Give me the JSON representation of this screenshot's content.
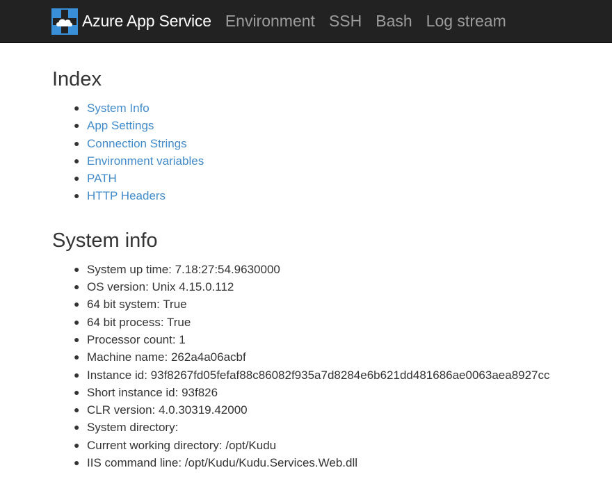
{
  "navbar": {
    "brand": "Azure App Service",
    "brand_icon": "azure-app-service-icon",
    "links": [
      "Environment",
      "SSH",
      "Bash",
      "Log stream"
    ]
  },
  "index": {
    "heading": "Index",
    "items": [
      "System Info",
      "App Settings",
      "Connection Strings",
      "Environment variables",
      "PATH",
      "HTTP Headers"
    ]
  },
  "system_info": {
    "heading": "System info",
    "items": [
      "System up time: 7.18:27:54.9630000",
      "OS version: Unix 4.15.0.112",
      "64 bit system: True",
      "64 bit process: True",
      "Processor count: 1",
      "Machine name: 262a4a06acbf",
      "Instance id: 93f8267fd05fefaf88c86082f935a7d8284e6b621dd481686ae0063aea8927cc",
      "Short instance id: 93f826",
      "CLR version: 4.0.30319.42000",
      "System directory:",
      "Current working directory: /opt/Kudu",
      "IIS command line: /opt/Kudu/Kudu.Services.Web.dll"
    ]
  },
  "colors": {
    "navbar_bg": "#222222",
    "brand_text": "#ffffff",
    "nav_link": "#9d9d9d",
    "link": "#428bca",
    "text": "#333333",
    "logo_blue": "#3a8fd9"
  }
}
